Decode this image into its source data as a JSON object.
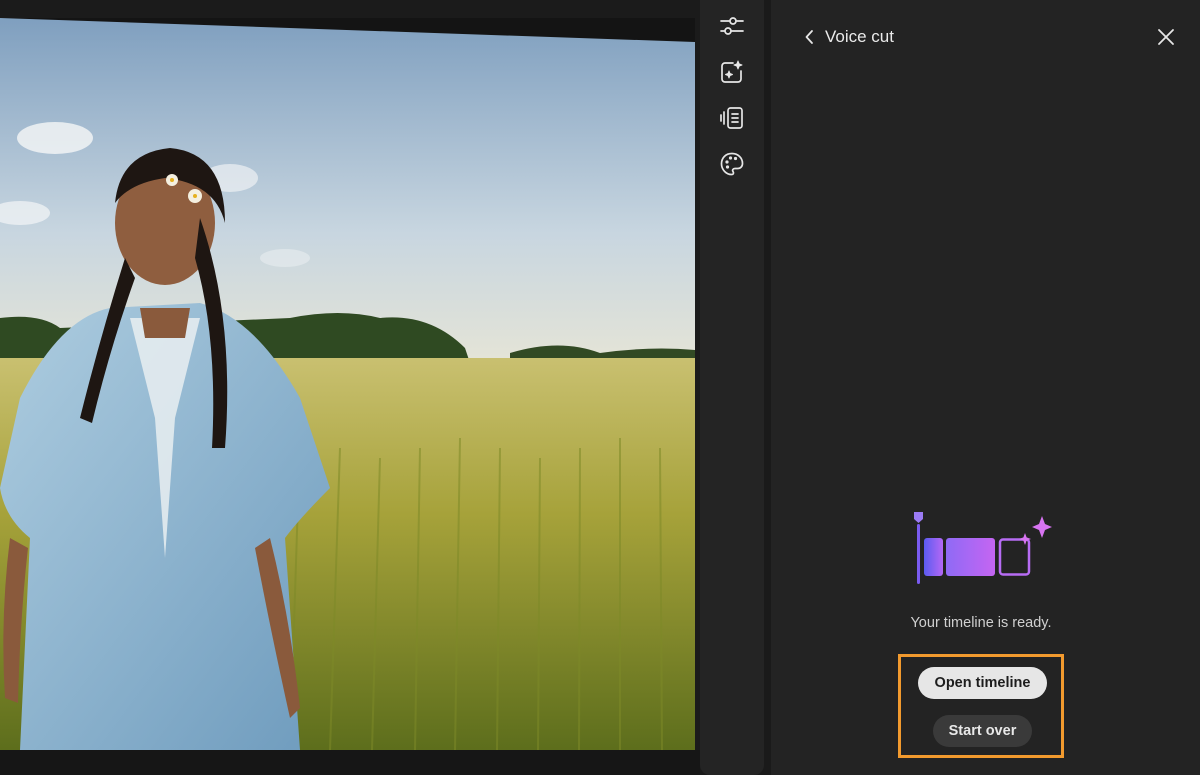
{
  "preview": {
    "scene": "video-frame"
  },
  "rail": {
    "items": [
      {
        "icon": "adjustments-sliders-icon"
      },
      {
        "icon": "ai-magic-icon"
      },
      {
        "icon": "transcript-icon"
      },
      {
        "icon": "color-palette-icon"
      }
    ]
  },
  "panel": {
    "title": "Voice cut",
    "status": "Your timeline is ready.",
    "primary_label": "Open timeline",
    "secondary_label": "Start over",
    "highlight_color": "#f29a2e"
  }
}
